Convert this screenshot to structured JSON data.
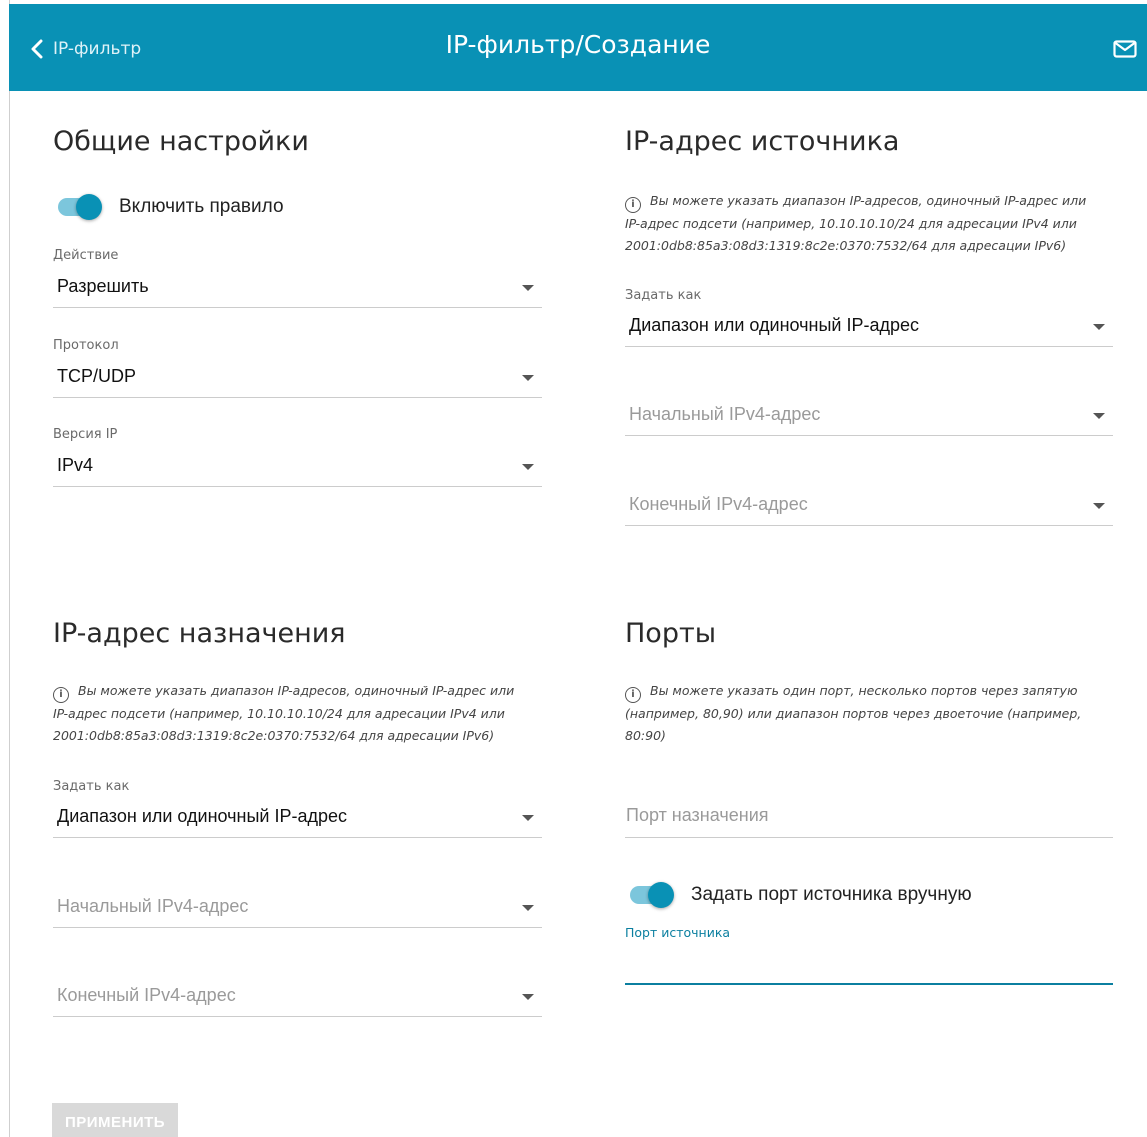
{
  "header": {
    "back_label": "IP-фильтр",
    "title": "IP-фильтр/Создание",
    "bg_color": "#0991b5"
  },
  "general": {
    "title": "Общие настройки",
    "enable_rule": {
      "label": "Включить правило",
      "on": true
    },
    "action": {
      "label": "Действие",
      "value": "Разрешить"
    },
    "protocol": {
      "label": "Протокол",
      "value": "TCP/UDP"
    },
    "ip_version": {
      "label": "Версия IP",
      "value": "IPv4"
    }
  },
  "source": {
    "title": "IP-адрес источника",
    "info": "Вы можете указать диапазон IP-адресов, одиночный IP-адрес или IP-адрес подсети (например, 10.10.10.10/24 для адресации IPv4 или 2001:0db8:85a3:08d3:1319:8c2e:0370:7532/64 для адресации IPv6)",
    "set_as": {
      "label": "Задать как",
      "value": "Диапазон или одиночный IP-адрес"
    },
    "start_ip": {
      "placeholder": "Начальный IPv4-адрес"
    },
    "end_ip": {
      "placeholder": "Конечный IPv4-адрес"
    }
  },
  "destination": {
    "title": "IP-адрес назначения",
    "info": "Вы можете указать диапазон IP-адресов, одиночный IP-адрес или IP-адрес подсети (например, 10.10.10.10/24 для адресации IPv4 или 2001:0db8:85a3:08d3:1319:8c2e:0370:7532/64 для адресации IPv6)",
    "set_as": {
      "label": "Задать как",
      "value": "Диапазон или одиночный IP-адрес"
    },
    "start_ip": {
      "placeholder": "Начальный IPv4-адрес"
    },
    "end_ip": {
      "placeholder": "Конечный IPv4-адрес"
    }
  },
  "ports": {
    "title": "Порты",
    "info": "Вы можете указать один порт, несколько портов через запятую (например, 80,90) или диапазон портов через двоеточие (например, 80:90)",
    "dest_port": {
      "placeholder": "Порт назначения"
    },
    "manual_source": {
      "label": "Задать порт источника вручную",
      "on": true
    },
    "source_port": {
      "label": "Порт источника",
      "value": ""
    }
  },
  "apply_button": "ПРИМЕНИТЬ"
}
